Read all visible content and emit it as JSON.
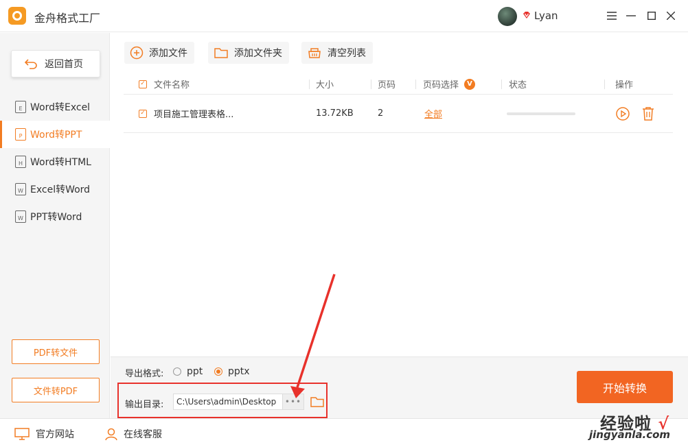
{
  "app": {
    "title": "金舟格式工厂",
    "accent_color": "#f27c22",
    "user": {
      "name": "Lyan"
    }
  },
  "window_controls": {
    "menu_icon": "hamburger-icon",
    "minimize_icon": "minimize-icon",
    "maximize_icon": "maximize-icon",
    "close_icon": "close-icon"
  },
  "sidebar": {
    "back_label": "返回首页",
    "items": [
      {
        "label": "Word转Excel",
        "icon_letter": "E",
        "active": false
      },
      {
        "label": "Word转PPT",
        "icon_letter": "P",
        "active": true
      },
      {
        "label": "Word转HTML",
        "icon_letter": "H",
        "active": false
      },
      {
        "label": "Excel转Word",
        "icon_letter": "W",
        "active": false
      },
      {
        "label": "PPT转Word",
        "icon_letter": "W",
        "active": false
      }
    ],
    "bottom_buttons": [
      "PDF转文件",
      "文件转PDF"
    ]
  },
  "toolbar": {
    "add_file": "添加文件",
    "add_folder": "添加文件夹",
    "clear_list": "清空列表"
  },
  "table": {
    "headers": {
      "name": "文件名称",
      "size": "大小",
      "pages": "页码",
      "page_select": "页码选择",
      "page_select_badge": "V",
      "status": "状态",
      "actions": "操作"
    },
    "rows": [
      {
        "checked": true,
        "name": "项目施工管理表格...",
        "size": "13.72KB",
        "pages": "2",
        "page_select": "全部",
        "progress": 0
      }
    ]
  },
  "output": {
    "format_label": "导出格式:",
    "formats": [
      {
        "label": "ppt",
        "selected": false
      },
      {
        "label": "pptx",
        "selected": true
      }
    ],
    "dir_label": "输出目录:",
    "dir_value": "C:\\Users\\admin\\Desktop",
    "browse_label": "•••",
    "start_button": "开始转换"
  },
  "statusbar": {
    "website": "官方网站",
    "support": "在线客服"
  },
  "watermark": {
    "text_cn": "经验啦",
    "check": "√",
    "url": "jingyanla.com"
  }
}
